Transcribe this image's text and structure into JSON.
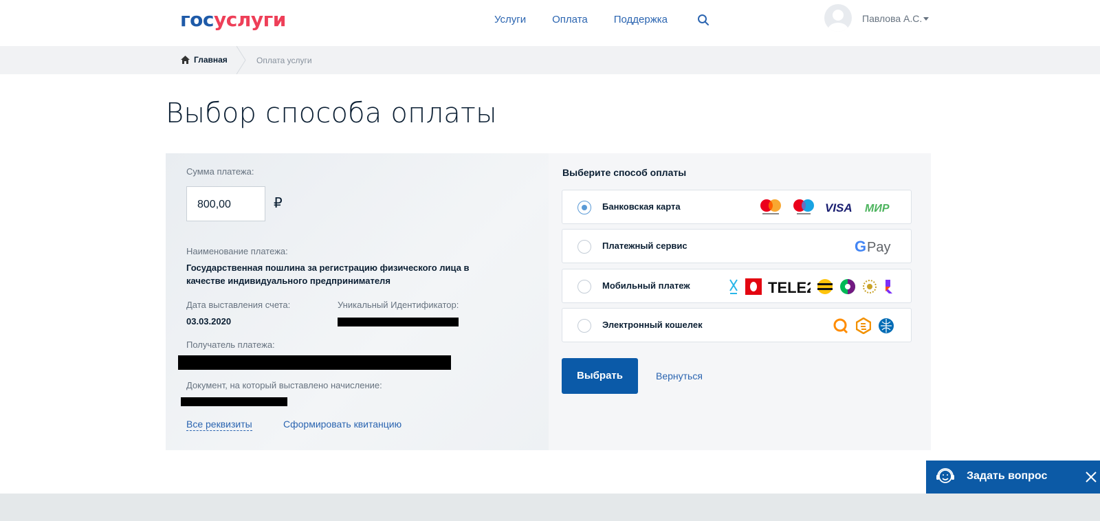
{
  "header": {
    "logo_part1": "гос",
    "logo_part2": "услуги",
    "nav": [
      "Услуги",
      "Оплата",
      "Поддержка"
    ],
    "user_name": "Павлова А.С."
  },
  "breadcrumb": {
    "home": "Главная",
    "current": "Оплата услуги"
  },
  "page_title": "Выбор способа оплаты",
  "payment_details": {
    "amount_label": "Сумма платежа:",
    "amount_value": "800,00",
    "currency_symbol": "₽",
    "name_label": "Наименование платежа:",
    "name_value": "Государственная пошлина за регистрацию физического лица в качестве индивидуального предпринимателя",
    "invoice_date_label": "Дата выставления счета:",
    "invoice_date_value": "03.03.2020",
    "uid_label": "Уникальный Идентификатор:",
    "recipient_label": "Получатель платежа:",
    "document_label": "Документ, на который выставлено начисление:",
    "all_details_link": "Все реквизиты",
    "form_receipt_link": "Сформировать квитанцию"
  },
  "payment_methods": {
    "title": "Выберите способ оплаты",
    "options": [
      {
        "label": "Банковская карта",
        "selected": true,
        "logos": [
          "mastercard",
          "maestro",
          "VISA",
          "МИР"
        ]
      },
      {
        "label": "Платежный сервис",
        "selected": false,
        "logos": [
          "G Pay"
        ]
      },
      {
        "label": "Мобильный платеж",
        "selected": false,
        "logos": [
          "yota",
          "mts",
          "TELE2",
          "beeline",
          "megafon",
          "tinkoff-mobile",
          "rostelecom"
        ]
      },
      {
        "label": "Электронный кошелек",
        "selected": false,
        "logos": [
          "qiwi",
          "yandex-money",
          "webmoney"
        ]
      }
    ],
    "choose_button": "Выбрать",
    "back_link": "Вернуться"
  },
  "ask_widget": {
    "label": "Задать вопрос"
  },
  "colors": {
    "brand_blue": "#0c5aa6",
    "brand_red": "#ee3f58",
    "link_blue": "#2a64b0"
  }
}
